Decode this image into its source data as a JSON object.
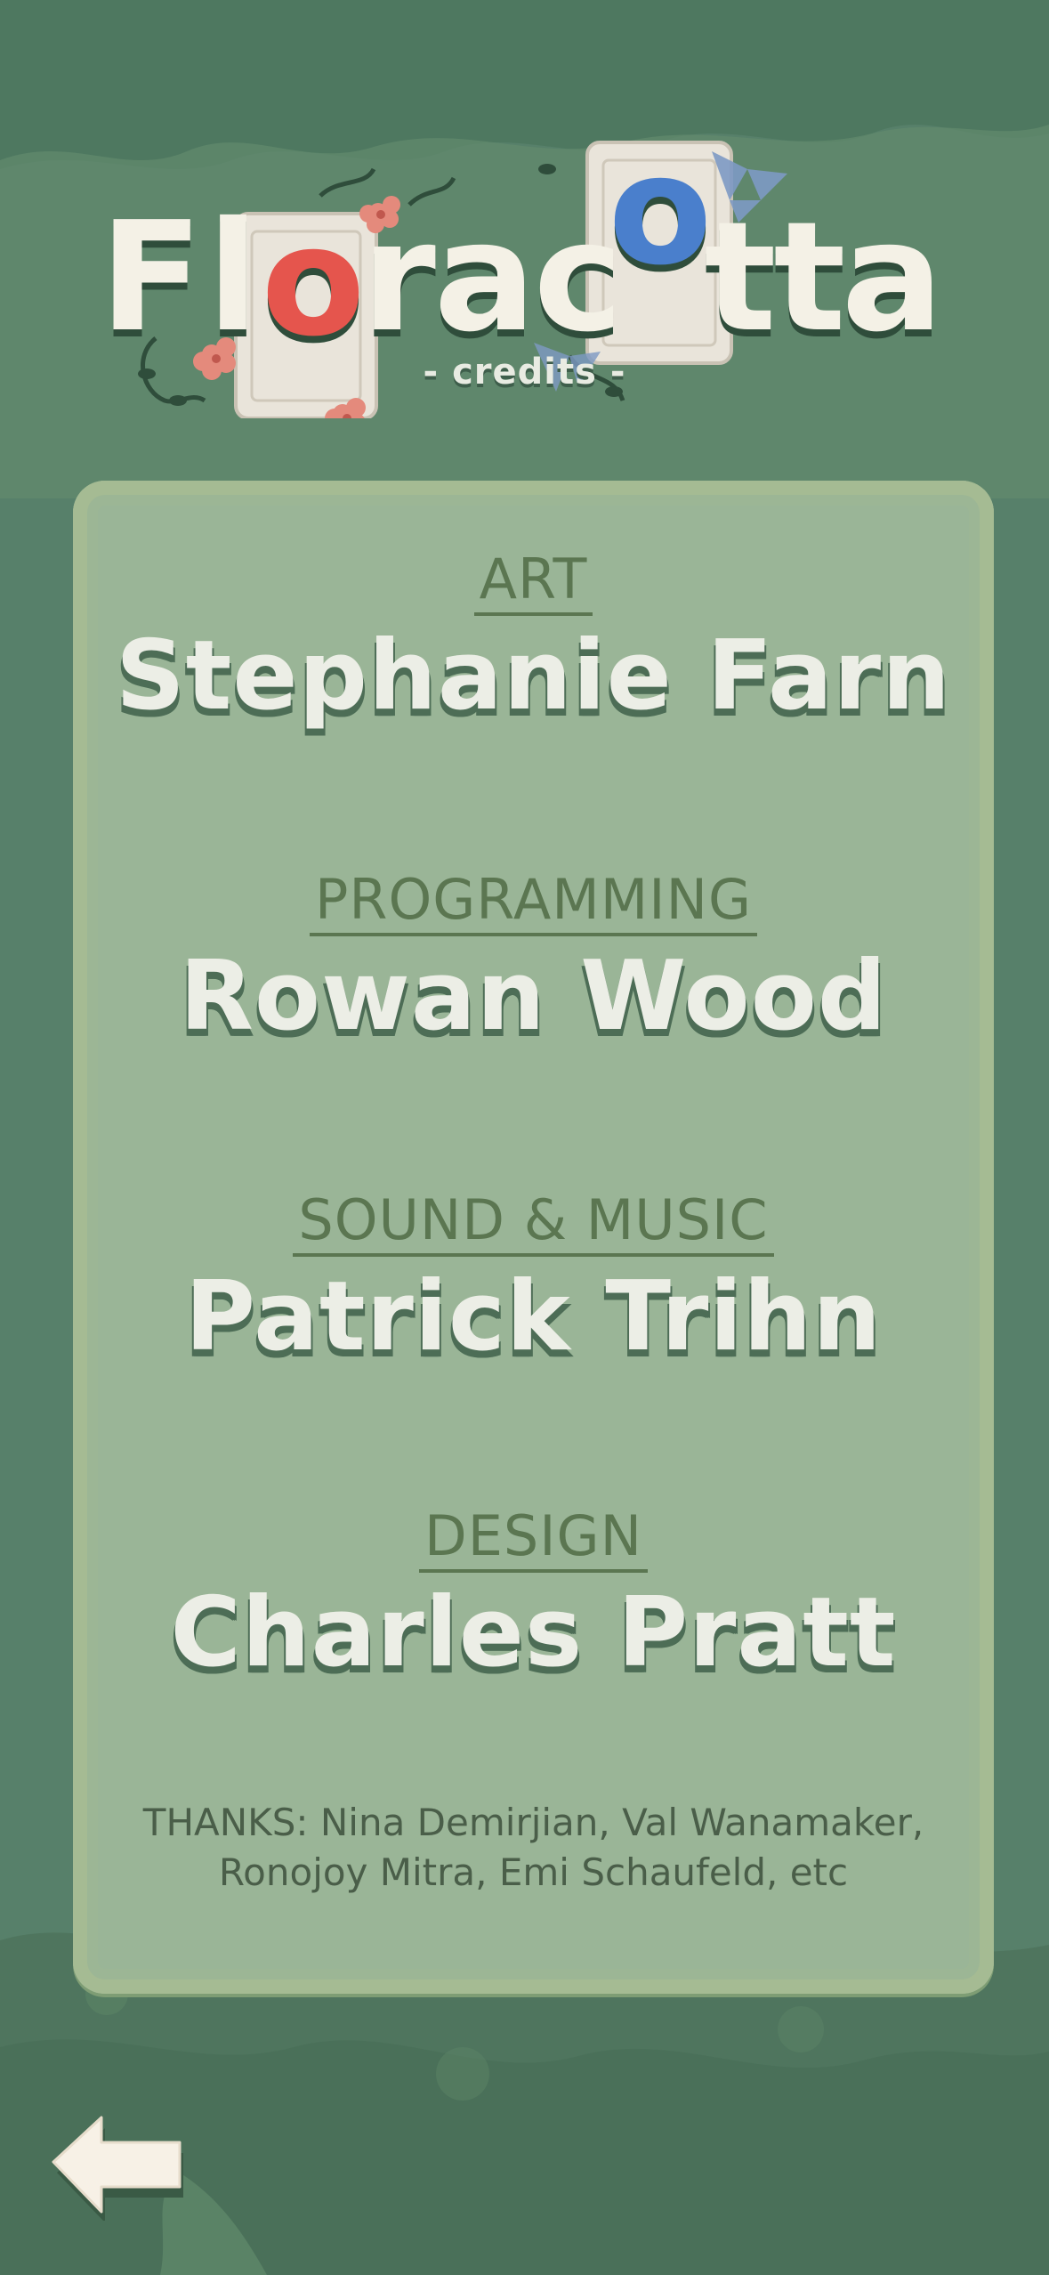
{
  "game": {
    "title_letters": [
      "F",
      "l",
      "o",
      "r",
      "a",
      "c",
      "o",
      "t",
      "t",
      "a"
    ],
    "subtitle": "- credits -"
  },
  "credits": [
    {
      "role": "ART",
      "name": "Stephanie Farn"
    },
    {
      "role": "PROGRAMMING",
      "name": "Rowan Wood"
    },
    {
      "role": "SOUND & MUSIC",
      "name": "Patrick Trihn"
    },
    {
      "role": "DESIGN",
      "name": "Charles Pratt"
    }
  ],
  "thanks": {
    "line1": "THANKS: Nina Demirjian, Val Wanamaker,",
    "line2": "Ronojoy Mitra, Emi Schaufeld, etc"
  },
  "colors": {
    "background": "#57806a",
    "panel": "#9ab597",
    "role_text": "#5b7651",
    "name_text": "#eceee6",
    "accent_red": "#e5554d",
    "accent_blue": "#4a7fcc"
  },
  "icons": {
    "back": "back-arrow-icon"
  }
}
